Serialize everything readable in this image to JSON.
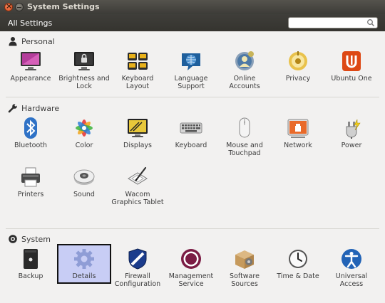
{
  "window": {
    "title": "System Settings"
  },
  "toolbar": {
    "breadcrumb": "All Settings",
    "search_placeholder": "",
    "search_value": ""
  },
  "sections": {
    "personal": {
      "title": "Personal",
      "items": [
        {
          "label": "Appearance"
        },
        {
          "label": "Brightness and Lock"
        },
        {
          "label": "Keyboard Layout"
        },
        {
          "label": "Language Support"
        },
        {
          "label": "Online Accounts"
        },
        {
          "label": "Privacy"
        },
        {
          "label": "Ubuntu One"
        }
      ]
    },
    "hardware": {
      "title": "Hardware",
      "items": [
        {
          "label": "Bluetooth"
        },
        {
          "label": "Color"
        },
        {
          "label": "Displays"
        },
        {
          "label": "Keyboard"
        },
        {
          "label": "Mouse and Touchpad"
        },
        {
          "label": "Network"
        },
        {
          "label": "Power"
        },
        {
          "label": "Printers"
        },
        {
          "label": "Sound"
        },
        {
          "label": "Wacom Graphics Tablet"
        }
      ]
    },
    "system": {
      "title": "System",
      "items": [
        {
          "label": "Backup"
        },
        {
          "label": "Details"
        },
        {
          "label": "Firewall Configuration"
        },
        {
          "label": "Management Service"
        },
        {
          "label": "Software Sources"
        },
        {
          "label": "Time & Date"
        },
        {
          "label": "Universal Access"
        }
      ]
    }
  },
  "colors": {
    "selection": "#c8cdf5",
    "titlebar": "#3c3b37",
    "accent": "#dd4814"
  }
}
